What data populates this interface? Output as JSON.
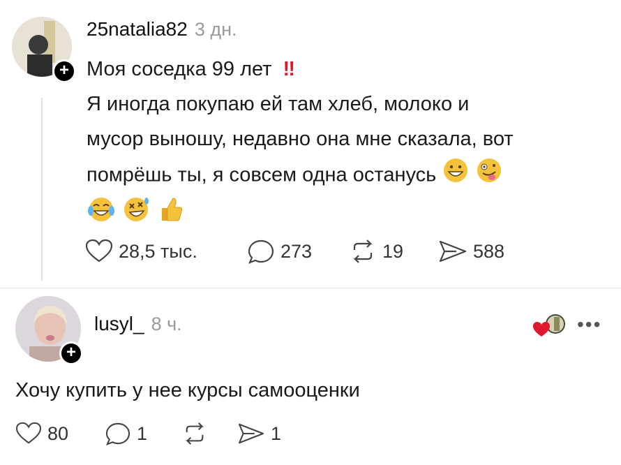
{
  "post": {
    "username": "25natalia82",
    "time": "3 дн.",
    "title_line": "Моя соседка 99 лет",
    "title_mark": "‼",
    "text_lines": [
      "Я иногда покупаю ей там хлеб, молоко и",
      "мусор выношу, недавно она мне сказала, вот",
      "помрёшь ты, я совсем одна останусь"
    ],
    "emojis_line3": [
      "grinning-face",
      "zany-face"
    ],
    "emojis_line4": [
      "tears-of-joy",
      "rolling-laughing",
      "thumbs-up"
    ],
    "actions": {
      "likes": "28,5 тыс.",
      "comments": "273",
      "reposts": "19",
      "shares": "588"
    }
  },
  "reply": {
    "username": "lusyl_",
    "time": "8 ч.",
    "text": "Хочу купить у нее курсы самооценки",
    "actions": {
      "likes": "80",
      "comments": "1",
      "reposts": "",
      "shares": "1"
    }
  },
  "colors": {
    "muted": "#9a9a9a",
    "mark": "#e0182d",
    "emoji": "#f5c23b"
  }
}
